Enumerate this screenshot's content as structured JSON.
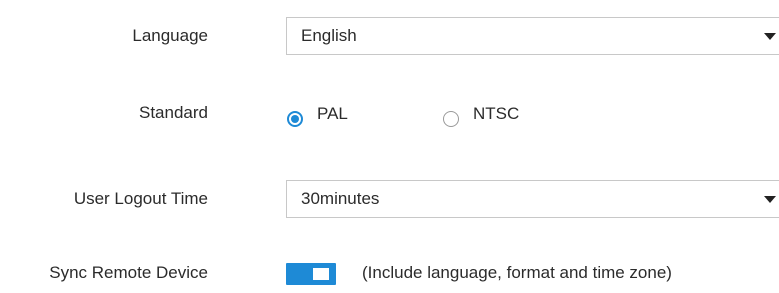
{
  "language": {
    "label": "Language",
    "value": "English"
  },
  "standard": {
    "label": "Standard",
    "options": [
      {
        "label": "PAL",
        "selected": true
      },
      {
        "label": "NTSC",
        "selected": false
      }
    ]
  },
  "logout": {
    "label": "User Logout Time",
    "value": "30minutes"
  },
  "sync": {
    "label": "Sync Remote Device",
    "enabled": true,
    "hint": "(Include language, format and time zone)"
  },
  "colors": {
    "accent": "#1e8ad6",
    "border": "#c8c8c8",
    "text": "#2b2b2b"
  },
  "icons": {
    "select_caret": "chevron-down-icon"
  }
}
